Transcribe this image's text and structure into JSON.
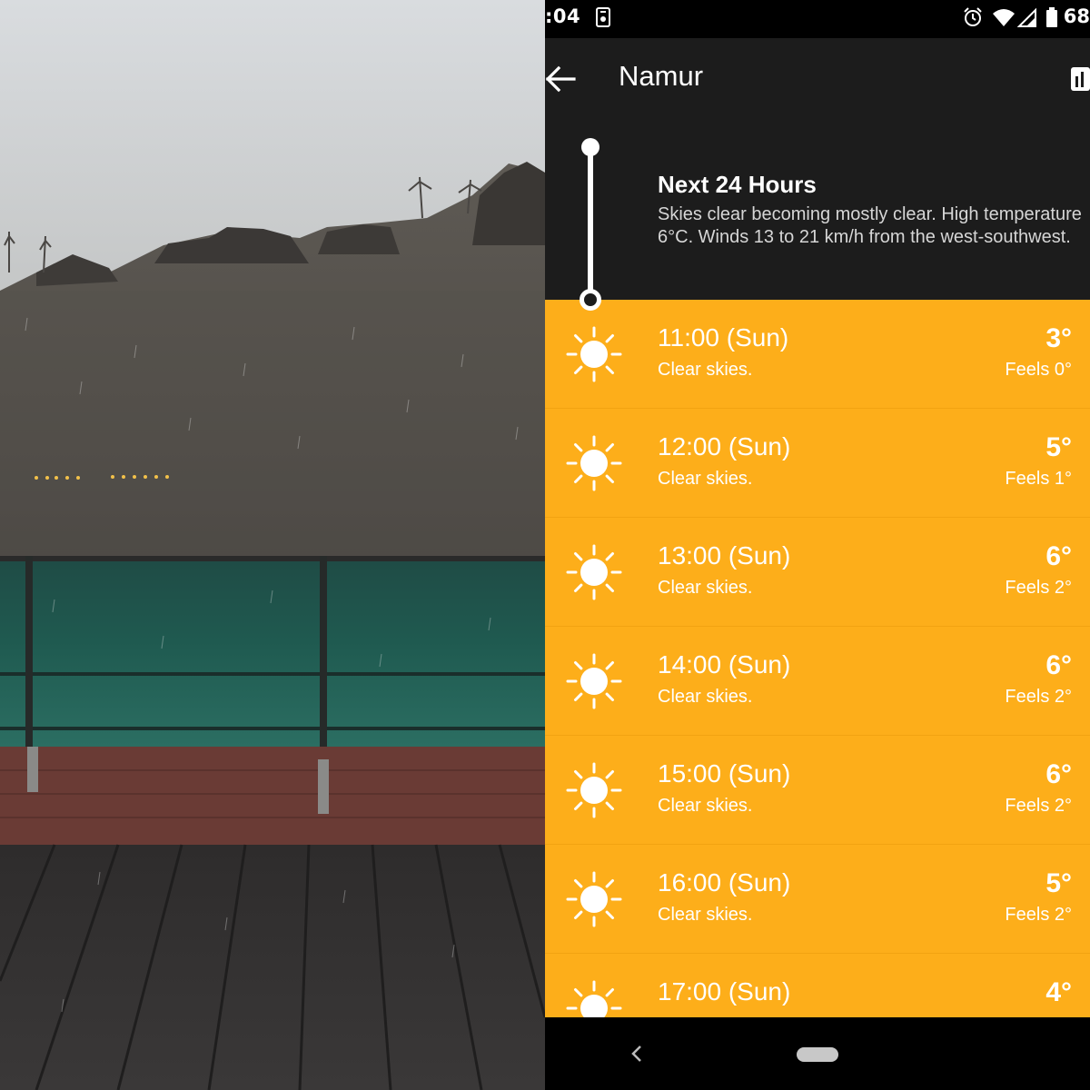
{
  "status_bar": {
    "time": ":04",
    "battery": "68",
    "icons": [
      "screenshot-icon",
      "alarm-icon",
      "wifi-icon",
      "signal-icon",
      "battery-icon"
    ]
  },
  "toolbar": {
    "title": "Namur",
    "back_icon": "arrow-left-icon",
    "chart_icon": "bar-chart-icon"
  },
  "summary": {
    "title": "Next 24 Hours",
    "text": "Skies clear becoming mostly clear. High temperature 6°C. Winds 13 to 21 km/h from the west-southwest."
  },
  "hourly": [
    {
      "time": "11:00 (Sun)",
      "condition": "Clear skies.",
      "temp": "3°",
      "feels": "Feels 0°",
      "icon": "sun-icon"
    },
    {
      "time": "12:00 (Sun)",
      "condition": "Clear skies.",
      "temp": "5°",
      "feels": "Feels 1°",
      "icon": "sun-icon"
    },
    {
      "time": "13:00 (Sun)",
      "condition": "Clear skies.",
      "temp": "6°",
      "feels": "Feels 2°",
      "icon": "sun-icon"
    },
    {
      "time": "14:00 (Sun)",
      "condition": "Clear skies.",
      "temp": "6°",
      "feels": "Feels 2°",
      "icon": "sun-icon"
    },
    {
      "time": "15:00 (Sun)",
      "condition": "Clear skies.",
      "temp": "6°",
      "feels": "Feels 2°",
      "icon": "sun-icon"
    },
    {
      "time": "16:00 (Sun)",
      "condition": "Clear skies.",
      "temp": "5°",
      "feels": "Feels 2°",
      "icon": "sun-icon"
    },
    {
      "time": "17:00 (Sun)",
      "condition": "",
      "temp": "4°",
      "feels": "",
      "icon": "sun-icon"
    }
  ],
  "colors": {
    "accent": "#fdae1a",
    "dark_bg": "#1c1c1c",
    "statusbar": "#000000"
  }
}
